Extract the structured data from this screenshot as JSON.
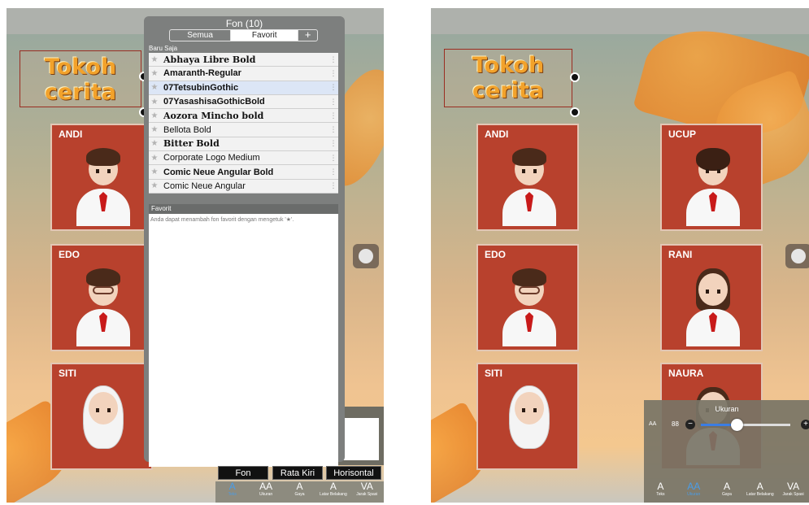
{
  "left": {
    "title_lines": [
      "Tokoh",
      "cerita"
    ],
    "cards": [
      {
        "name": "ANDI"
      },
      {
        "name": "EDO"
      },
      {
        "name": "SITI"
      }
    ],
    "font_panel": {
      "title": "Fon (10)",
      "segments": [
        "Semua",
        "Favorit",
        "+"
      ],
      "recent_label": "Baru Saja",
      "fonts": [
        {
          "name": "Abhaya Libre Bold",
          "selected": false
        },
        {
          "name": "Amaranth-Regular",
          "selected": false
        },
        {
          "name": "07TetsubinGothic",
          "selected": true
        },
        {
          "name": "07YasashisaGothicBold",
          "selected": false
        },
        {
          "name": "Aozora Mincho bold",
          "selected": false
        },
        {
          "name": "Bellota Bold",
          "selected": false
        },
        {
          "name": "Bitter Bold",
          "selected": false
        },
        {
          "name": "Corporate Logo Medium",
          "selected": false
        },
        {
          "name": "Comic Neue Angular Bold",
          "selected": false
        },
        {
          "name": "Comic Neue Angular",
          "selected": false
        }
      ],
      "favorites_label": "Favorit",
      "favorites_hint": "Anda dapat menambah fon favorit dengan mengetuk '★'."
    },
    "subbar": [
      "Fon",
      "Rata Kiri",
      "Horisontal"
    ],
    "tabs": [
      {
        "icon": "A",
        "label": "Teks",
        "active": true
      },
      {
        "icon": "AA",
        "label": "Ukuran",
        "active": false
      },
      {
        "icon": "A",
        "label": "Gaya",
        "active": false
      },
      {
        "icon": "A",
        "label": "Latar Belakang",
        "active": false
      },
      {
        "icon": "VA",
        "label": "Jarak Spasi",
        "active": false
      }
    ]
  },
  "right": {
    "title_lines": [
      "Tokoh",
      "cerita"
    ],
    "cards": [
      {
        "name": "ANDI"
      },
      {
        "name": "UCUP"
      },
      {
        "name": "EDO"
      },
      {
        "name": "RANI"
      },
      {
        "name": "SITI"
      },
      {
        "name": "NAURA"
      }
    ],
    "size_panel": {
      "title": "Ukuran",
      "aa_label": "AA",
      "value": "88",
      "minus": "−",
      "plus": "+",
      "slider_fraction": 0.4
    },
    "tabs": [
      {
        "icon": "A",
        "label": "Teks",
        "active": false
      },
      {
        "icon": "AA",
        "label": "Ukuran",
        "active": true
      },
      {
        "icon": "A",
        "label": "Gaya",
        "active": false
      },
      {
        "icon": "A",
        "label": "Latar Belakang",
        "active": false
      },
      {
        "icon": "VA",
        "label": "Jarak Spasi",
        "active": false
      }
    ]
  },
  "colors": {
    "accent": "#4a9de8",
    "card": "#b8412d",
    "title": "#f2a22b"
  }
}
